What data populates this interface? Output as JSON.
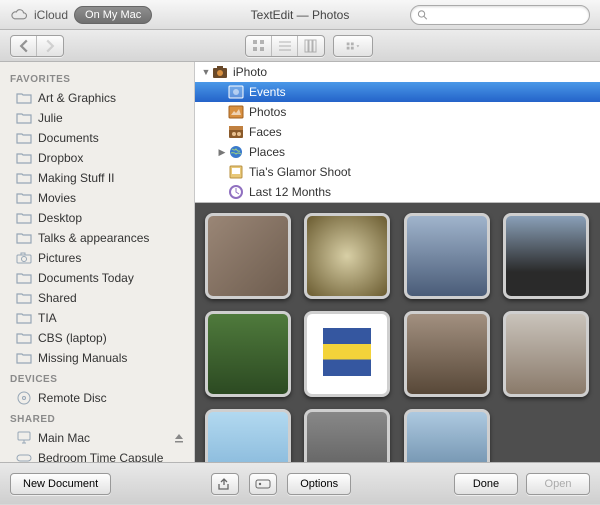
{
  "titlebar": {
    "cloud_label": "iCloud",
    "pill_label": "On My Mac",
    "title": "TextEdit — Photos",
    "search_placeholder": ""
  },
  "sidebar": {
    "groups": [
      {
        "header": "FAVORITES",
        "items": [
          {
            "label": "Art & Graphics",
            "icon": "folder"
          },
          {
            "label": "Julie",
            "icon": "folder"
          },
          {
            "label": "Documents",
            "icon": "folder"
          },
          {
            "label": "Dropbox",
            "icon": "folder"
          },
          {
            "label": "Making Stuff II",
            "icon": "folder"
          },
          {
            "label": "Movies",
            "icon": "folder"
          },
          {
            "label": "Desktop",
            "icon": "folder"
          },
          {
            "label": "Talks & appearances",
            "icon": "folder"
          },
          {
            "label": "Pictures",
            "icon": "camera"
          },
          {
            "label": "Documents Today",
            "icon": "folder"
          },
          {
            "label": "Shared",
            "icon": "folder"
          },
          {
            "label": "TIA",
            "icon": "folder"
          },
          {
            "label": "CBS (laptop)",
            "icon": "folder"
          },
          {
            "label": "Missing Manuals",
            "icon": "folder"
          }
        ]
      },
      {
        "header": "DEVICES",
        "items": [
          {
            "label": "Remote Disc",
            "icon": "disc"
          }
        ]
      },
      {
        "header": "SHARED",
        "items": [
          {
            "label": "Main Mac",
            "icon": "imac",
            "eject": true
          },
          {
            "label": "Bedroom Time Capsule",
            "icon": "capsule"
          }
        ]
      }
    ]
  },
  "outline": {
    "items": [
      {
        "label": "iPhoto",
        "icon": "iphoto",
        "depth": 0,
        "expanded": true
      },
      {
        "label": "Events",
        "icon": "events",
        "depth": 1,
        "selected": true
      },
      {
        "label": "Photos",
        "icon": "photos",
        "depth": 1
      },
      {
        "label": "Faces",
        "icon": "faces",
        "depth": 1
      },
      {
        "label": "Places",
        "icon": "places",
        "depth": 1,
        "expandable": true
      },
      {
        "label": "Tia's Glamor Shoot",
        "icon": "album",
        "depth": 1
      },
      {
        "label": "Last 12 Months",
        "icon": "smart",
        "depth": 1
      }
    ]
  },
  "footer": {
    "new_document": "New Document",
    "options": "Options",
    "done": "Done",
    "open": "Open"
  }
}
